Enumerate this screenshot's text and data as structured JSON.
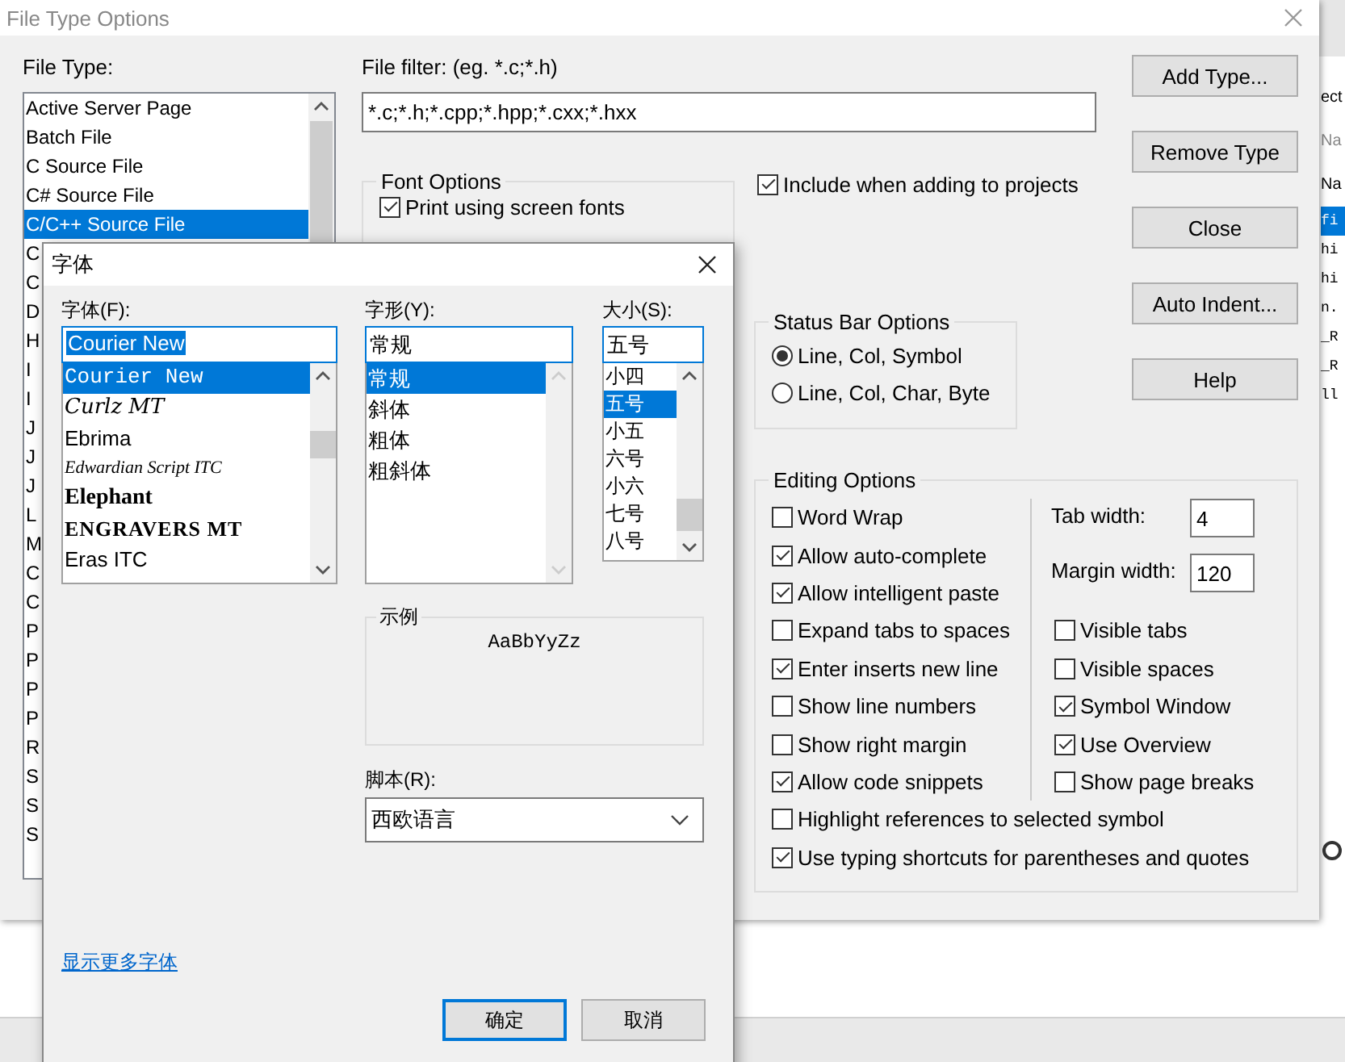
{
  "file_type_window": {
    "title": "File Type Options"
  },
  "file_type": {
    "label": "File Type:",
    "items": [
      {
        "label": "Active Server Page",
        "selected": false
      },
      {
        "label": "Batch File",
        "selected": false
      },
      {
        "label": "C Source File",
        "selected": false
      },
      {
        "label": "C# Source File",
        "selected": false
      },
      {
        "label": "C/C++ Source File",
        "selected": true
      },
      {
        "label": "C",
        "selected": false
      },
      {
        "label": "C",
        "selected": false
      },
      {
        "label": "D",
        "selected": false
      },
      {
        "label": "H",
        "selected": false
      },
      {
        "label": "I",
        "selected": false
      },
      {
        "label": "I",
        "selected": false
      },
      {
        "label": "J",
        "selected": false
      },
      {
        "label": "J",
        "selected": false
      },
      {
        "label": "J",
        "selected": false
      },
      {
        "label": "L",
        "selected": false
      },
      {
        "label": "M",
        "selected": false
      },
      {
        "label": "C",
        "selected": false
      },
      {
        "label": "C",
        "selected": false
      },
      {
        "label": "P",
        "selected": false
      },
      {
        "label": "P",
        "selected": false
      },
      {
        "label": "P",
        "selected": false
      },
      {
        "label": "P",
        "selected": false
      },
      {
        "label": "R",
        "selected": false
      },
      {
        "label": "S",
        "selected": false
      },
      {
        "label": "S",
        "selected": false
      },
      {
        "label": "S",
        "selected": false
      }
    ]
  },
  "file_filter": {
    "label": "File filter: (eg. *.c;*.h)",
    "value": "*.c;*.h;*.cpp;*.hpp;*.cxx;*.hxx"
  },
  "font_options": {
    "title": "Font Options",
    "options": [
      {
        "label": "Print using screen fonts",
        "checked": true
      }
    ]
  },
  "include_in_projects": {
    "label": "Include when adding to projects",
    "checked": true
  },
  "status_bar_options": {
    "title": "Status Bar Options",
    "options": [
      {
        "label": "Line, Col, Symbol",
        "selected": true
      },
      {
        "label": "Line, Col, Char, Byte",
        "selected": false
      }
    ]
  },
  "editing_options": {
    "title": "Editing Options",
    "left": [
      {
        "label": "Word Wrap",
        "checked": false
      },
      {
        "label": "Allow auto-complete",
        "checked": true
      },
      {
        "label": "Allow intelligent paste",
        "checked": true
      },
      {
        "label": "Expand tabs to spaces",
        "checked": false
      },
      {
        "label": "Enter inserts new line",
        "checked": true
      },
      {
        "label": "Show line numbers",
        "checked": false
      },
      {
        "label": "Show right margin",
        "checked": false
      },
      {
        "label": "Allow code snippets",
        "checked": true
      }
    ],
    "fields": [
      {
        "label": "Tab width:",
        "value": "4"
      },
      {
        "label": "Margin width:",
        "value": "120"
      }
    ],
    "right": [
      {
        "label": "Visible tabs",
        "checked": false
      },
      {
        "label": "Visible spaces",
        "checked": false
      },
      {
        "label": "Symbol Window",
        "checked": true
      },
      {
        "label": "Use Overview",
        "checked": true
      },
      {
        "label": "Show page breaks",
        "checked": false
      }
    ],
    "bottom": [
      {
        "label": "Highlight references to selected symbol",
        "checked": false
      },
      {
        "label": "Use typing shortcuts for parentheses and quotes",
        "checked": true
      }
    ]
  },
  "buttons": [
    {
      "label": "Add Type..."
    },
    {
      "label": "Remove Type"
    },
    {
      "label": "Close"
    },
    {
      "label": "Auto Indent..."
    },
    {
      "label": "Help"
    }
  ],
  "background_editor": {
    "lines": [
      {
        "text": "ect",
        "kind": "header",
        "selected": false
      },
      {
        "text": "Na",
        "kind": "hint",
        "selected": false
      },
      {
        "text": "Na",
        "kind": "header",
        "selected": false
      },
      {
        "text": "fi",
        "kind": "code",
        "selected": true
      },
      {
        "text": "hi",
        "kind": "code",
        "selected": false
      },
      {
        "text": "hi",
        "kind": "code",
        "selected": false
      },
      {
        "text": "n.",
        "kind": "code",
        "selected": false
      },
      {
        "text": "_R",
        "kind": "code",
        "selected": false
      },
      {
        "text": "_R",
        "kind": "code",
        "selected": false
      },
      {
        "text": "ll",
        "kind": "code",
        "selected": false
      }
    ]
  },
  "font_dialog": {
    "title": "字体",
    "font": {
      "label": "字体(F):",
      "value": "Courier New",
      "items": [
        {
          "label": "Courier New",
          "kind": "mono",
          "selected": true
        },
        {
          "label": "Curlz MT",
          "kind": "decorative",
          "selected": false
        },
        {
          "label": "Ebrima",
          "kind": "sans",
          "selected": false
        },
        {
          "label": "Edwardian Script ITC",
          "kind": "script",
          "selected": false
        },
        {
          "label": "Elephant",
          "kind": "bold",
          "selected": false
        },
        {
          "label": "ENGRAVERS MT",
          "kind": "engraved",
          "selected": false
        },
        {
          "label": "Eras ITC",
          "kind": "sans",
          "selected": false
        }
      ]
    },
    "style": {
      "label": "字形(Y):",
      "value": "常规",
      "items": [
        {
          "label": "常规",
          "selected": true
        },
        {
          "label": "斜体",
          "selected": false
        },
        {
          "label": "粗体",
          "selected": false
        },
        {
          "label": "粗斜体",
          "selected": false
        }
      ]
    },
    "size": {
      "label": "大小(S):",
      "value": "五号",
      "items": [
        {
          "label": "小四",
          "selected": false
        },
        {
          "label": "五号",
          "selected": true
        },
        {
          "label": "小五",
          "selected": false
        },
        {
          "label": "六号",
          "selected": false
        },
        {
          "label": "小六",
          "selected": false
        },
        {
          "label": "七号",
          "selected": false
        },
        {
          "label": "八号",
          "selected": false
        }
      ]
    },
    "sample": {
      "title": "示例",
      "text": "AaBbYyZz"
    },
    "script": {
      "label": "脚本(R):",
      "value": "西欧语言"
    },
    "more_fonts_link": "显示更多字体",
    "buttons": [
      {
        "label": "确定",
        "default": true
      },
      {
        "label": "取消",
        "default": false
      }
    ]
  }
}
